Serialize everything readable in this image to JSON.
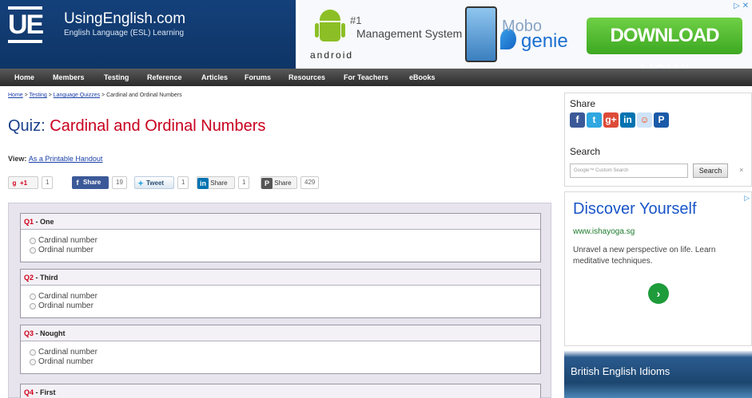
{
  "header": {
    "logo": "UE",
    "site_name": "UsingEnglish.com",
    "tagline": "English Language (ESL) Learning"
  },
  "ad_banner": {
    "rank": "#1",
    "headline": "Management System",
    "android_word": "android",
    "brand_top": "Mobo",
    "brand_bottom": "genie",
    "cta": "DOWNLOAD NOW!",
    "choice": "▷ ✕"
  },
  "nav": {
    "items": [
      "Home",
      "Members",
      "Testing",
      "Reference",
      "Articles",
      "Forums",
      "Resources",
      "For Teachers",
      "eBooks"
    ]
  },
  "breadcrumb": {
    "home": "Home",
    "sep": " > ",
    "testing": "Testing",
    "quizzes": "Language Quizzes",
    "current": "Cardinal and Ordinal Numbers"
  },
  "quiz": {
    "prefix": "Quiz:",
    "title": "Cardinal and Ordinal Numbers",
    "view_label": "View:",
    "view_link": "As a Printable Handout",
    "questions": [
      {
        "num": "Q1",
        "sep": " - ",
        "word": "One",
        "options": [
          "Cardinal number",
          "Ordinal number"
        ]
      },
      {
        "num": "Q2",
        "sep": " - ",
        "word": "Third",
        "options": [
          "Cardinal number",
          "Ordinal number"
        ]
      },
      {
        "num": "Q3",
        "sep": " - ",
        "word": "Nought",
        "options": [
          "Cardinal number",
          "Ordinal number"
        ]
      },
      {
        "num": "Q4",
        "sep": " - ",
        "word": "First",
        "options": []
      }
    ]
  },
  "share_bar": {
    "gplus_label": "+1",
    "gplus_count": "1",
    "fb_label": "Share",
    "fb_count": "19",
    "tw_label": "Tweet",
    "tw_count": "1",
    "li_label": "Share",
    "li_count": "1",
    "pin_label": "Share",
    "pin_count": "429"
  },
  "sidebar": {
    "share_title": "Share",
    "search_title": "Search",
    "search_placeholder": "Google™ Custom Search",
    "search_button": "Search",
    "search_clear": "×",
    "ad": {
      "title": "Discover Yourself",
      "url": "www.ishayoga.sg",
      "text": "Unravel a new perspective on life. Learn meditative techniques.",
      "go": "›",
      "choice": "▷"
    },
    "idioms": "British English Idioms"
  },
  "colors": {
    "header_blue": "#14407a",
    "title_red": "#c8001e",
    "link_blue": "#1a3fa8",
    "quiz_bg": "#e7e4ee",
    "download_green": "#3da822"
  }
}
